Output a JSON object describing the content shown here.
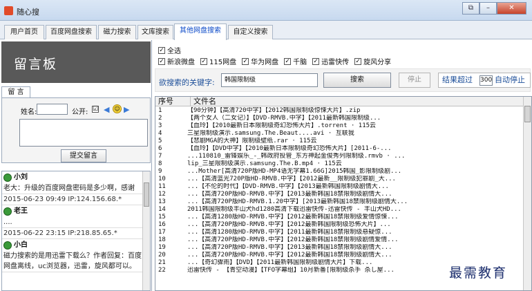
{
  "window": {
    "title": "随心搜"
  },
  "tabs": [
    {
      "label": "用户首页"
    },
    {
      "label": "百度网盘搜索"
    },
    {
      "label": "磁力搜索"
    },
    {
      "label": "文库搜索"
    },
    {
      "label": "其他网盘搜索"
    },
    {
      "label": "自定义搜索"
    }
  ],
  "guestbook": {
    "title": "留言板",
    "tab_label": "留 言",
    "name_label": "姓名:",
    "public_label": "公开:",
    "public_checked": "☑",
    "submit_label": "提交留言",
    "messages": [
      {
        "author": "小刘",
        "text": "老大：升级的百度网盘密码是多少啊，感谢",
        "meta": "2015-06-23 09:49 IP:124.156.68.*"
      },
      {
        "author": "老王",
        "text": "....",
        "meta": "2015-06-22 23:15 IP:218.85.65.*"
      },
      {
        "author": "小白",
        "text": "磁力搜索的是用迅雷下载么？作者回复：百度网盘离线，uc浏览器，迅雷，旋风都可以。",
        "meta": ""
      }
    ]
  },
  "filters": {
    "all": {
      "label": "全选",
      "checked": true
    },
    "items": [
      {
        "label": "新浪微盘",
        "checked": true
      },
      {
        "label": "115网盘",
        "checked": true
      },
      {
        "label": "华为网盘",
        "checked": true
      },
      {
        "label": "千脑",
        "checked": true
      },
      {
        "label": "迅雷快传",
        "checked": true
      },
      {
        "label": "旋风分享",
        "checked": true
      }
    ]
  },
  "search": {
    "keyword_label": "欲搜索的关键字:",
    "keyword_value": "韩国限制级",
    "search_label": "搜索",
    "stop_label": "停止",
    "limit_prefix": "结果超过",
    "limit_value": "300",
    "limit_suffix": "自动停止"
  },
  "results": {
    "header_num": "序号",
    "header_file": "文件名",
    "rows": [
      {
        "num": "1",
        "file": "【90分钟】【高清720中字】【2012韩国限制级惊悚大片】.zip"
      },
      {
        "num": "2",
        "file": "【两个女人（二女记）】【DVD-RMVB.中字】【2011最新韩国限制级..."
      },
      {
        "num": "3",
        "file": "【血玲】【2010最新日本限制级奇幻恐怖大片】.torrent · 115云"
      },
      {
        "num": "4",
        "file": "三星限制级演示.samsung.The.Beaut....avi · 互联我"
      },
      {
        "num": "5",
        "file": "【悲剧MGA的大神】限制级壁纸.rar · 115云"
      },
      {
        "num": "6",
        "file": "【血玲】【DVD中字】【2010最新日本限制级奇幻恐怖大片】[2011-6-..."
      },
      {
        "num": "7",
        "file": "...110810_雷锋娱乐_-_韩政府投管_东方神起金俊秀列限制级.rmvb · ..."
      },
      {
        "num": "8",
        "file": "lip_三星限制级演示.samsung.The.B.mp4 · 115云"
      },
      {
        "num": "9",
        "file": "...Mother[高清720P版HD-MP4语无字幕1.66G]2015韩国_影限制级剧..."
      },
      {
        "num": "10",
        "file": "...【高清蓝光720P版HD-RMVB.中字】【2012最新__限制级犯罪剧_大..."
      },
      {
        "num": "11",
        "file": "...【不伦的时代】【DVD-RMVB.中字】【2013最新韩国限制级剧情大..."
      },
      {
        "num": "12",
        "file": "...【高清720P版HD-RMVB.中字】【2013最新韩国18禁限制级剧情大..."
      },
      {
        "num": "13",
        "file": "...【高清720P版HD-RMVB.1.20中字】[2013最新韩国18禁限制级剧情大..."
      },
      {
        "num": "14",
        "file": "2011韩国限制级丰山犬hd1280高清下载迅雷快传-迅雷快传 - 丰山犬HD..."
      },
      {
        "num": "15",
        "file": "...【高清1280版HD-RMVB.中字】【2012最新韩国18禁限制级爱情惊悚..."
      },
      {
        "num": "16",
        "file": "...【高清720P版HD-RMVB.中字】【2012最新韩国限制级恐怖大片】..."
      },
      {
        "num": "17",
        "file": "...【高清1280版HD-RMVB.中字】【2011最新韩国18禁限制级悬疑惊..."
      },
      {
        "num": "18",
        "file": "...【高清720P版HD-RMVB.中字】【2012最新韩国18禁限制级剧情爱情..."
      },
      {
        "num": "19",
        "file": "...【高清720P版HD-RMVB.中字】【2013最新韩国18禁限制级剧情大..."
      },
      {
        "num": "20",
        "file": "...【高清720P版HD-RMVB.中字】【2012最新韩国18禁限制级剧情大..."
      },
      {
        "num": "21",
        "file": "...【奇幻骤雨】【DVD】【2011最新韩国限制级剧情大片】下载..."
      },
      {
        "num": "22",
        "file": "迅雷快传 - 【青空动漫】【TFO字幕组】10月新番[限制级杀手 杀し屋..."
      }
    ]
  },
  "watermark": "最需教育"
}
